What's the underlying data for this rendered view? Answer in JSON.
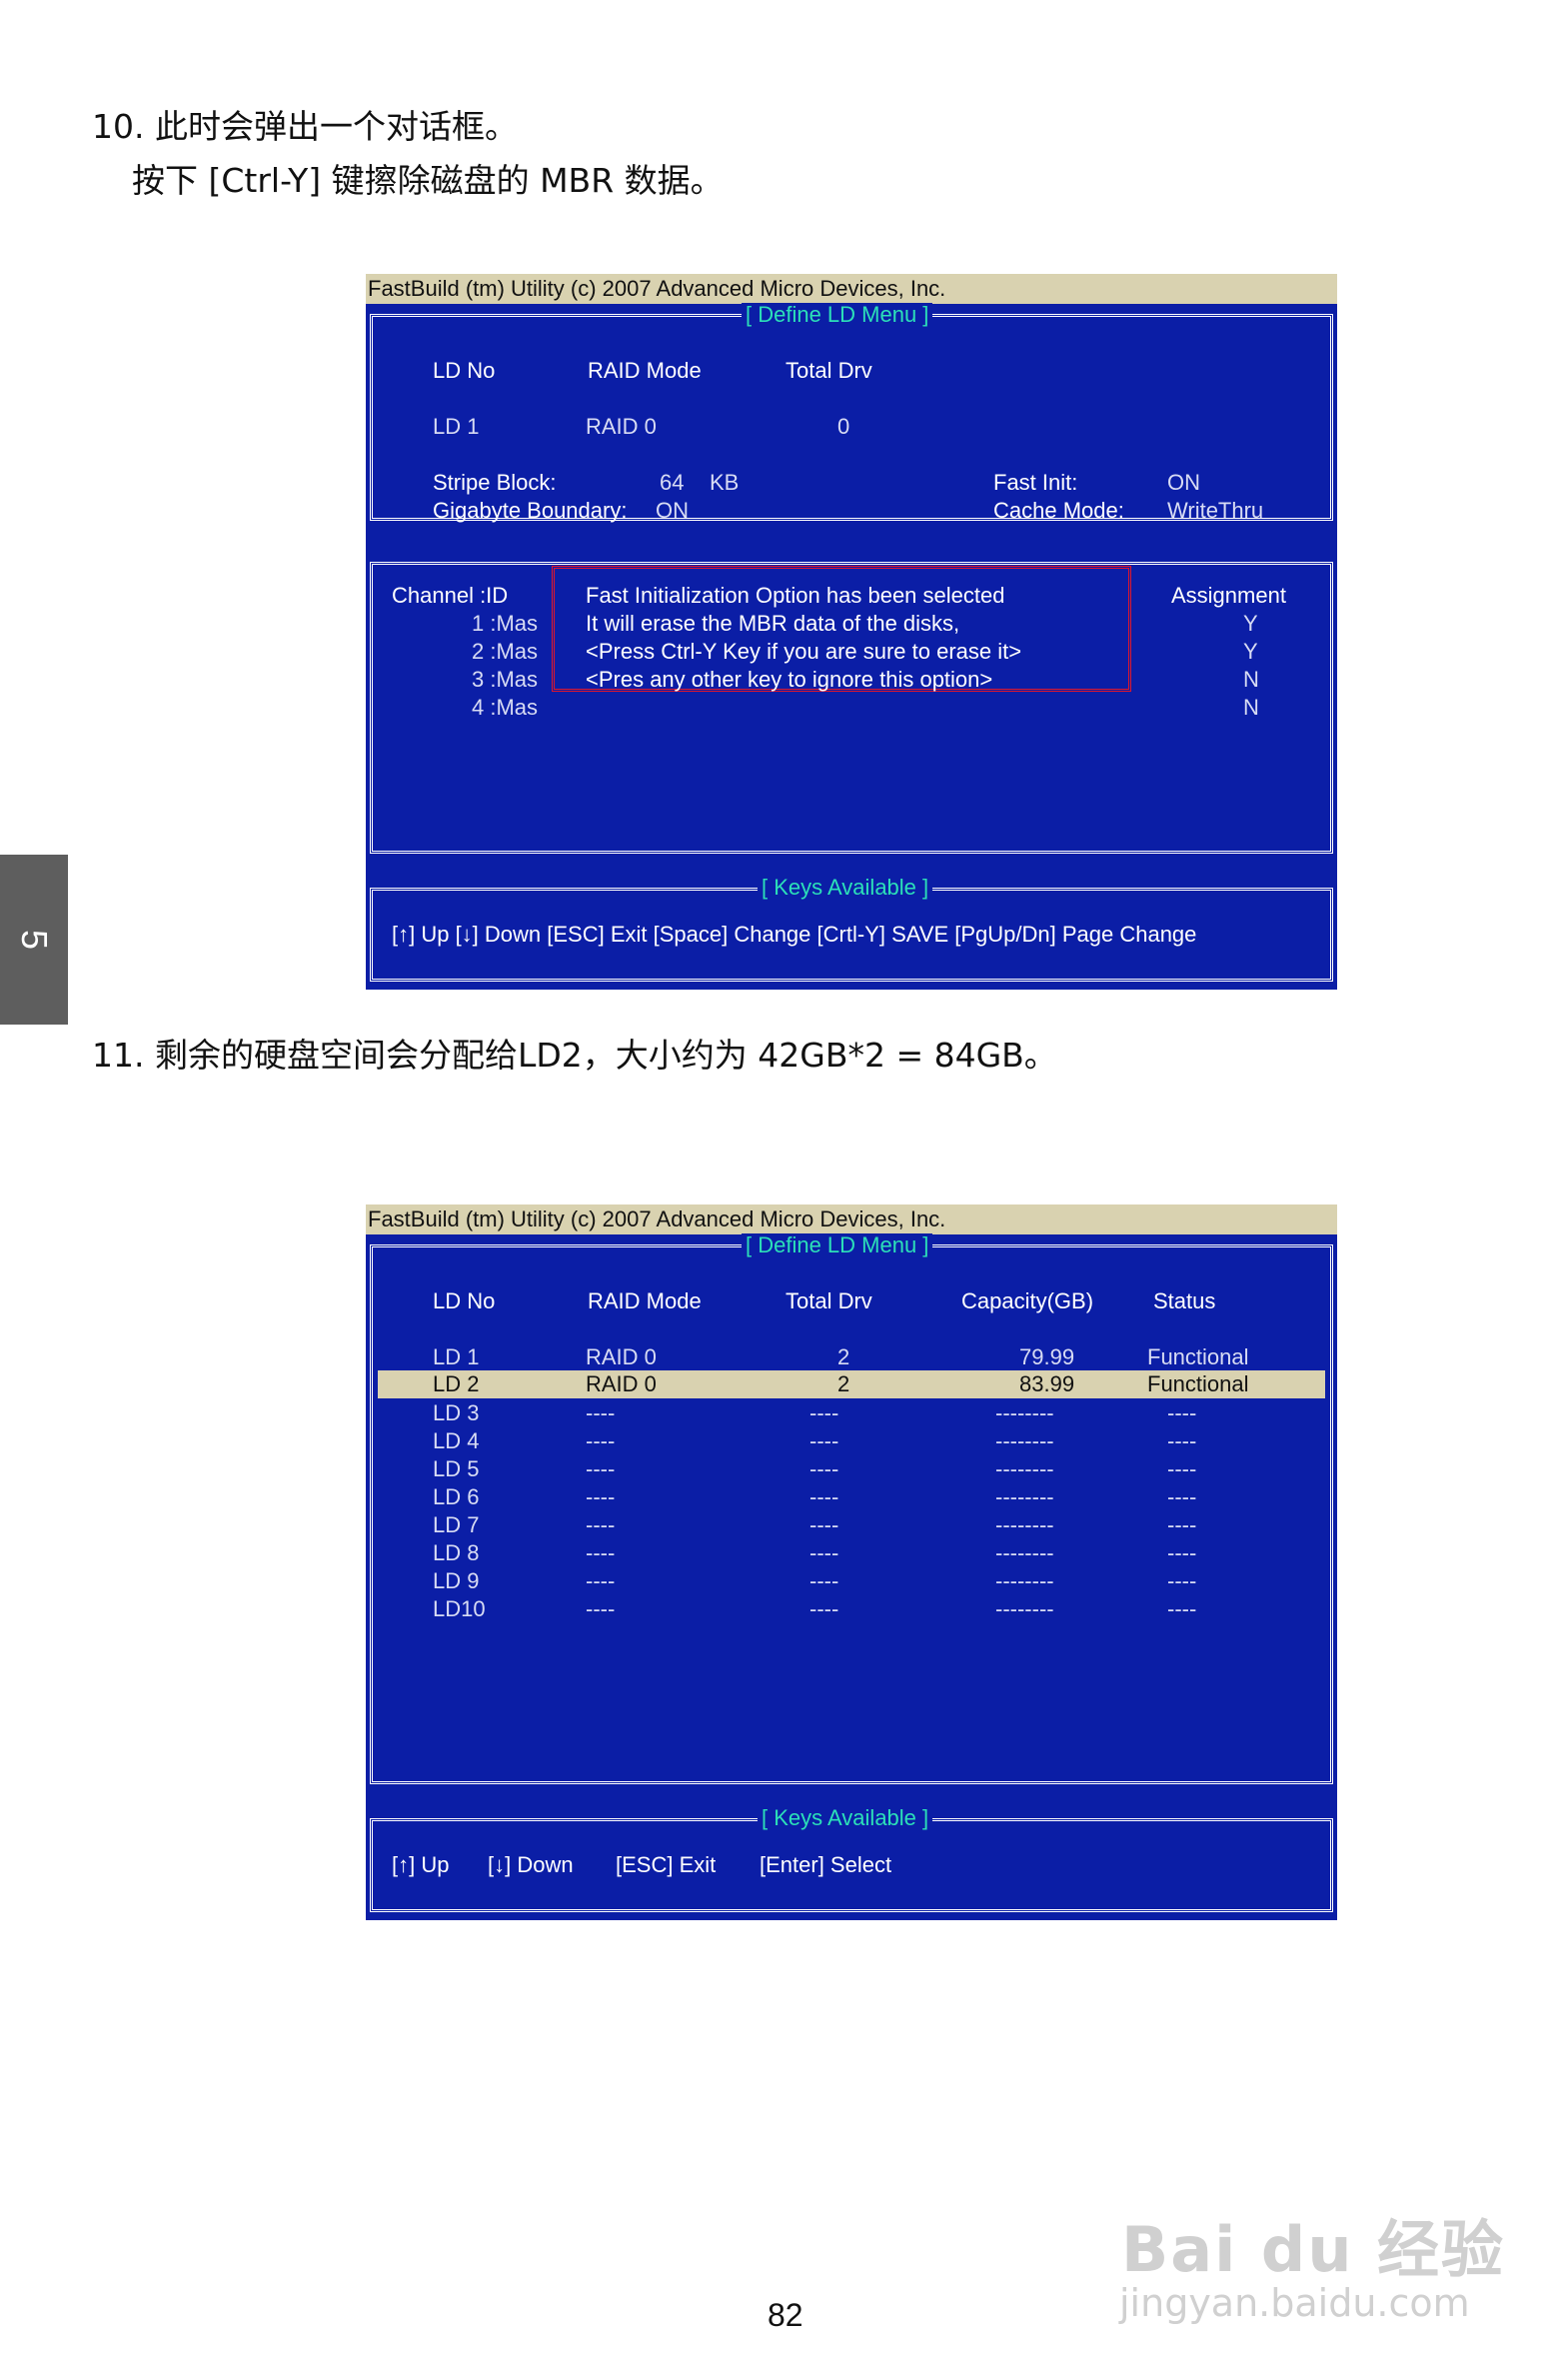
{
  "step10": {
    "number": "10.",
    "line1": "此时会弹出一个对话框。",
    "line2": "按下 [Ctrl-Y] 键擦除磁盘的 MBR 数据。"
  },
  "step11": {
    "number": "11.",
    "line1": "剩余的硬盘空间会分配给LD2，大小约为 42GB*2 = 84GB。"
  },
  "chapter_tab": "5",
  "screen1": {
    "title": "FastBuild (tm) Utility (c) 2007 Advanced Micro Devices, Inc.",
    "menu_title": "[ Define LD Menu ]",
    "headers": {
      "ld_no": "LD No",
      "raid_mode": "RAID Mode",
      "total_drv": "Total Drv"
    },
    "row": {
      "ld": "LD  1",
      "raid": "RAID 0",
      "drv": "0"
    },
    "stripe_label": "Stripe Block:",
    "stripe_value": "64",
    "stripe_unit": "KB",
    "gigabyte_label": "Gigabyte Boundary:",
    "gigabyte_value": "ON",
    "fastinit_label": "Fast Init:",
    "fastinit_value": "ON",
    "cache_label": "Cache Mode:",
    "cache_value": "WriteThru",
    "channel_header": "Channel  :ID",
    "channels": [
      "1 :Mas",
      "2 :Mas",
      "3 :Mas",
      "4 :Mas"
    ],
    "assignment_header": "Assignment",
    "assignments": [
      "Y",
      "Y",
      "N",
      "N"
    ],
    "dialog": [
      "Fast Initialization Option has been selected",
      "It will erase the MBR data of the disks,",
      "<Press Ctrl-Y Key if you are sure to erase it>",
      "<Pres any other key to ignore this option>"
    ],
    "keys_title": "[ Keys Available ]",
    "keys": "[↑] Up  [↓] Down  [ESC] Exit  [Space] Change  [Crtl-Y] SAVE   [PgUp/Dn] Page Change"
  },
  "screen2": {
    "title": "FastBuild (tm) Utility (c) 2007 Advanced Micro Devices, Inc.",
    "menu_title": "[ Define LD Menu ]",
    "headers": {
      "ld_no": "LD No",
      "raid_mode": "RAID Mode",
      "total_drv": "Total Drv",
      "capacity": "Capacity(GB)",
      "status": "Status"
    },
    "rows": [
      {
        "ld": "LD  1",
        "raid": "RAID 0",
        "drv": "2",
        "cap": "79.99",
        "status": "Functional"
      },
      {
        "ld": "LD  2",
        "raid": "RAID 0",
        "drv": "2",
        "cap": "83.99",
        "status": "Functional"
      },
      {
        "ld": "LD  3",
        "raid": "----",
        "drv": "----",
        "cap": "--------",
        "status": "----"
      },
      {
        "ld": "LD  4",
        "raid": "----",
        "drv": "----",
        "cap": "--------",
        "status": "----"
      },
      {
        "ld": "LD  5",
        "raid": "----",
        "drv": "----",
        "cap": "--------",
        "status": "----"
      },
      {
        "ld": "LD  6",
        "raid": "----",
        "drv": "----",
        "cap": "--------",
        "status": "----"
      },
      {
        "ld": "LD  7",
        "raid": "----",
        "drv": "----",
        "cap": "--------",
        "status": "----"
      },
      {
        "ld": "LD  8",
        "raid": "----",
        "drv": "----",
        "cap": "--------",
        "status": "----"
      },
      {
        "ld": "LD  9",
        "raid": "----",
        "drv": "----",
        "cap": "--------",
        "status": "----"
      },
      {
        "ld": "LD10",
        "raid": "----",
        "drv": "----",
        "cap": "--------",
        "status": "----"
      }
    ],
    "keys_title": "[ Keys Available ]",
    "keys": [
      "[↑] Up",
      "[↓] Down",
      "[ESC] Exit",
      "[Enter] Select"
    ]
  },
  "page_number": "82",
  "watermark": {
    "brand": "Bai du 经验",
    "url": "jingyan.baidu.com"
  }
}
